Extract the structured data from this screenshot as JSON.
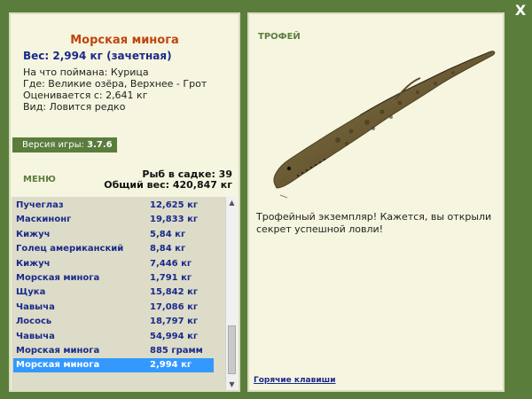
{
  "close_label": "X",
  "fish": {
    "name": "Морская минога",
    "weight": "Вес: 2,994 кг (зачетная)",
    "bait": "На что поймана: Курица",
    "location": "Где: Великие озёра, Верхнее - Грот",
    "valued_from": "Оценивается с: 2,641 кг",
    "kind": "Вид: Ловится редко"
  },
  "version": {
    "label": "Версия игры:",
    "value": "3.7.6"
  },
  "menu_label": "МЕНЮ",
  "stats": {
    "fish_in_keepnet": "Рыб в садке: 39",
    "total_weight": "Общий вес: 420,847 кг"
  },
  "catch_list": [
    {
      "name": "Пучеглаз",
      "weight": "12,625 кг"
    },
    {
      "name": "Маскинонг",
      "weight": "19,833 кг"
    },
    {
      "name": "Кижуч",
      "weight": "5,84 кг"
    },
    {
      "name": "Голец американский",
      "weight": "8,84 кг"
    },
    {
      "name": "Кижуч",
      "weight": "7,446 кг"
    },
    {
      "name": "Морская минога",
      "weight": "1,791 кг"
    },
    {
      "name": "Щука",
      "weight": "15,842 кг"
    },
    {
      "name": "Чавыча",
      "weight": "17,086 кг"
    },
    {
      "name": "Лосось",
      "weight": "18,797 кг"
    },
    {
      "name": "Чавыча",
      "weight": "54,994 кг"
    },
    {
      "name": "Морская минога",
      "weight": "885 грамм"
    },
    {
      "name": "Морская минога",
      "weight": "2,994 кг"
    }
  ],
  "selected_index": 11,
  "trophy": {
    "label": "ТРОФЕЙ",
    "text": "Трофейный экземпляр! Кажется, вы открыли секрет успешной ловли!"
  },
  "hotkeys_label": "Горячие клавиши",
  "colors": {
    "background": "#5b7d3c",
    "panel": "#f6f5df",
    "list_bg": "#dcdcc8",
    "fish_name": "#c0450f",
    "list_text": "#1b2a8a",
    "selection": "#3399ff"
  }
}
